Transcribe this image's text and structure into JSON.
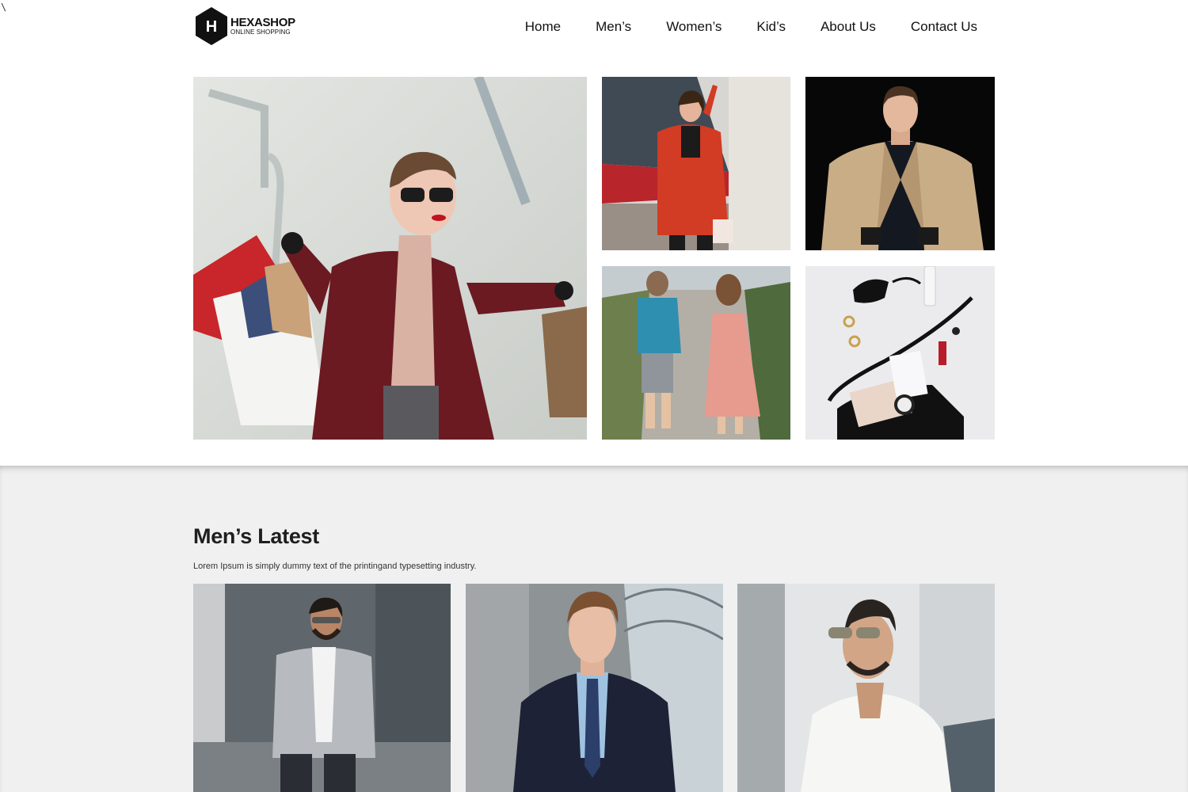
{
  "stray_mark": "\\",
  "brand": {
    "initial": "H",
    "name": "HEXASHOP",
    "tagline": "ONLINE SHOPPING"
  },
  "nav": {
    "items": [
      {
        "label": "Home"
      },
      {
        "label": "Men’s"
      },
      {
        "label": "Women’s"
      },
      {
        "label": "Kid’s"
      },
      {
        "label": "About Us"
      },
      {
        "label": "Contact Us"
      }
    ]
  },
  "section": {
    "title": "Men’s Latest",
    "subtitle": "Lorem Ipsum is simply dummy text of the printingand typesetting industry."
  },
  "colors": {
    "section_bg": "#f0f0f0",
    "text": "#1a1a1a",
    "logo_hex": "#111111"
  },
  "icons": [
    "hexagon-logo-icon"
  ]
}
